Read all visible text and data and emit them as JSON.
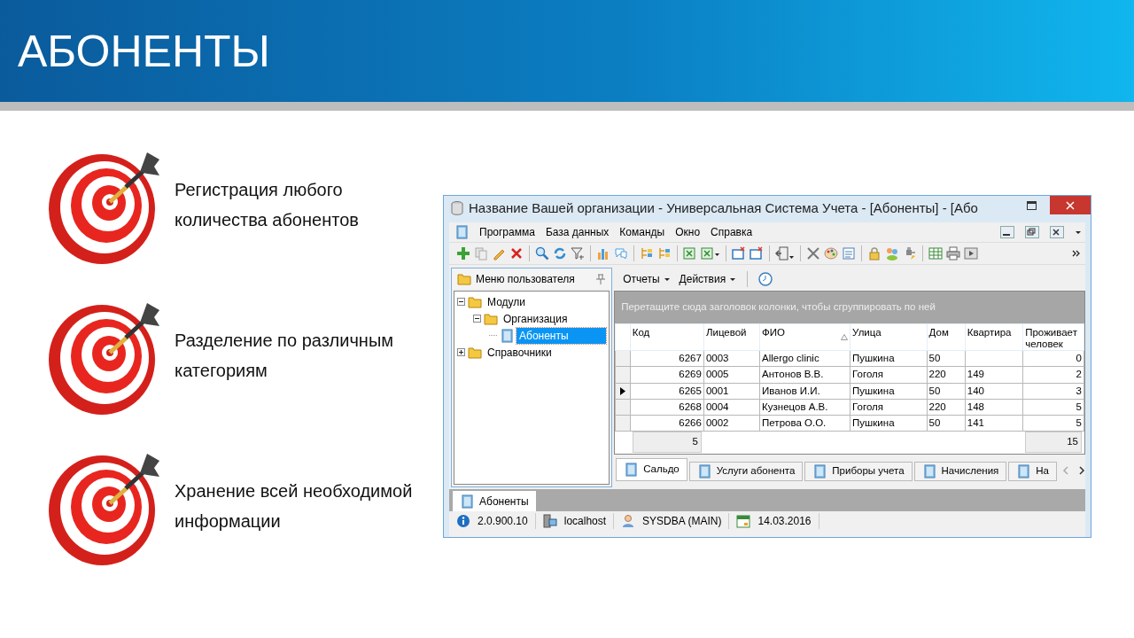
{
  "slide": {
    "title": "АБОНЕНТЫ"
  },
  "bullets": [
    {
      "lines": [
        "Регистрация любого",
        "количества абонентов"
      ]
    },
    {
      "lines": [
        "Разделение по различным",
        "категориям"
      ]
    },
    {
      "lines": [
        "Хранение всей необходимой",
        "информации"
      ]
    }
  ],
  "window": {
    "title": "Название Вашей организации - Универсальная Система Учета - [Абоненты] - [Або"
  },
  "menu": [
    "Программа",
    "База данных",
    "Команды",
    "Окно",
    "Справка"
  ],
  "side_panel": {
    "title": "Меню пользователя",
    "tree": [
      {
        "label": "Модули",
        "expanded": true,
        "selected": false,
        "children": [
          {
            "label": "Организация",
            "expanded": true,
            "selected": false,
            "children": [
              {
                "label": "Абоненты",
                "selected": true
              }
            ]
          }
        ]
      },
      {
        "label": "Справочники",
        "expanded": false,
        "selected": false
      }
    ]
  },
  "grid_toolbar": [
    "Отчеты",
    "Действия"
  ],
  "group_panel_hint": "Перетащите сюда заголовок колонки, чтобы сгруппировать по ней",
  "columns": [
    {
      "label": "Код",
      "kind": "number",
      "sorted": false
    },
    {
      "label": "Лицевой",
      "kind": "text",
      "sorted": false
    },
    {
      "label": "ФИО",
      "kind": "text",
      "sorted": true
    },
    {
      "label": "Улица",
      "kind": "text",
      "sorted": false
    },
    {
      "label": "Дом",
      "kind": "text",
      "sorted": false
    },
    {
      "label": "Квартира",
      "kind": "text",
      "sorted": false
    },
    {
      "label": "Проживает человек",
      "kind": "number",
      "sorted": false
    }
  ],
  "rows": [
    {
      "selected": false,
      "cells": [
        "6267",
        "0003",
        "Allergo clinic",
        "Пушкина",
        "50",
        null,
        "0"
      ]
    },
    {
      "selected": false,
      "cells": [
        "6269",
        "0005",
        "Антонов В.В.",
        "Гоголя",
        "220",
        "149",
        "2"
      ]
    },
    {
      "selected": true,
      "cells": [
        "6265",
        "0001",
        "Иванов И.И.",
        "Пушкина",
        "50",
        "140",
        "3"
      ]
    },
    {
      "selected": false,
      "cells": [
        "6268",
        "0004",
        "Кузнецов А.В.",
        "Гоголя",
        "220",
        "148",
        "5"
      ]
    },
    {
      "selected": false,
      "cells": [
        "6266",
        "0002",
        "Петрова О.О.",
        "Пушкина",
        "50",
        "141",
        "5"
      ]
    }
  ],
  "footer": {
    "count": "5",
    "total": "15"
  },
  "detail_tabs": [
    {
      "label": "Сальдо",
      "selected": true
    },
    {
      "label": "Услуги абонента",
      "selected": false
    },
    {
      "label": "Приборы учета",
      "selected": false
    },
    {
      "label": "Начисления",
      "selected": false
    },
    {
      "label": "На",
      "selected": false
    }
  ],
  "document_tabs": [
    {
      "label": "Абоненты",
      "selected": true
    }
  ],
  "status_bar": [
    {
      "kind": "version",
      "text": "2.0.900.10"
    },
    {
      "kind": "server",
      "text": "localhost"
    },
    {
      "kind": "user",
      "text": "SYSDBA (MAIN)"
    },
    {
      "kind": "date",
      "text": "14.03.2016"
    }
  ]
}
